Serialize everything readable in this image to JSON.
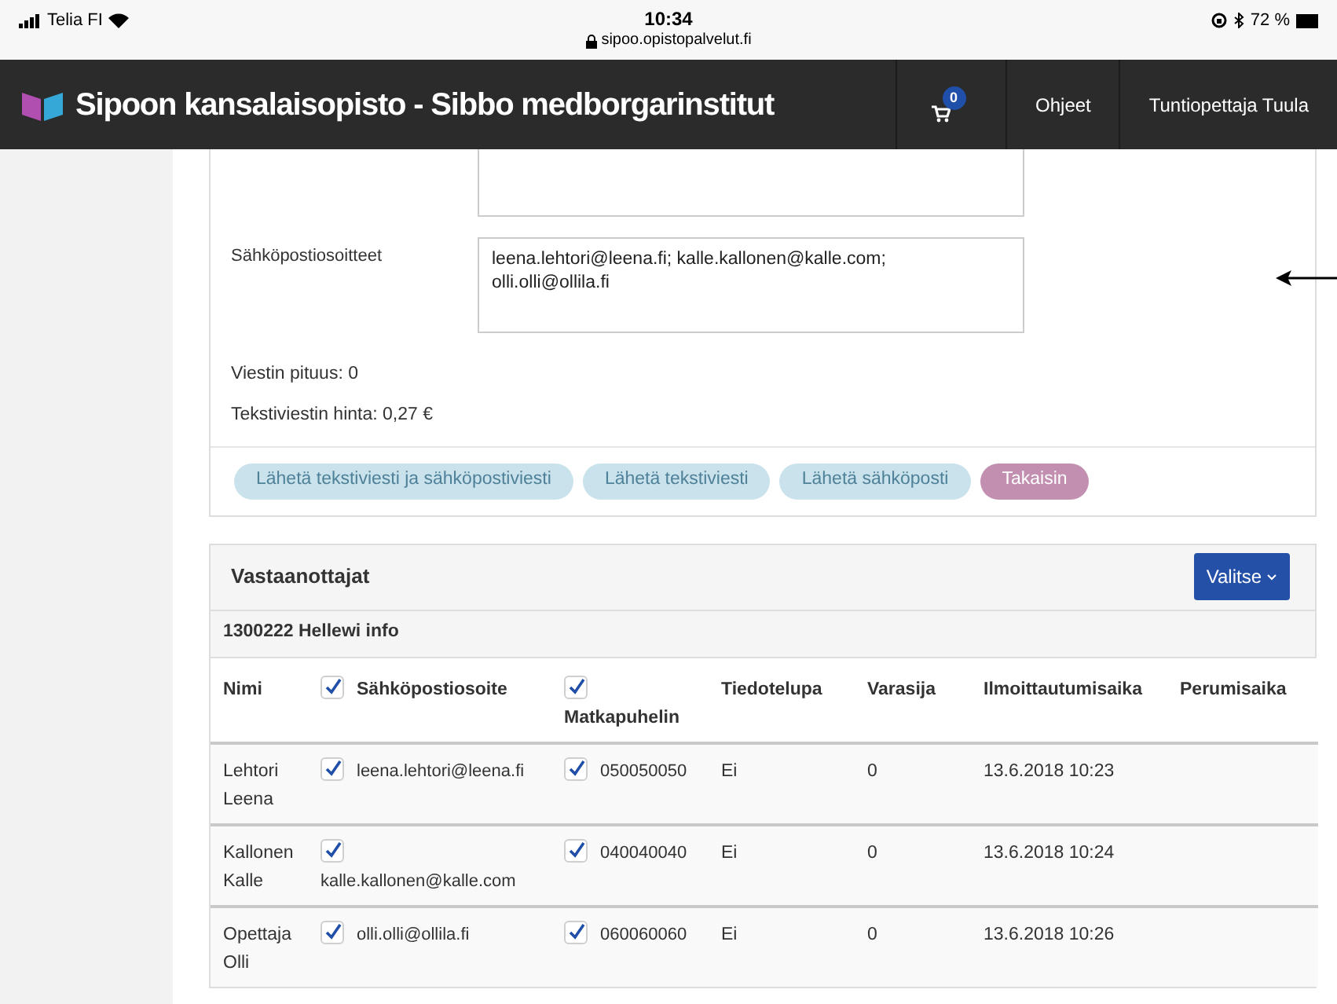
{
  "status_bar": {
    "carrier": "Telia FI",
    "time": "10:34",
    "url": "sipoo.opistopalvelut.fi",
    "battery": "72 %"
  },
  "navbar": {
    "title": "Sipoon kansalaisopisto - Sibbo medborgarinstitut",
    "cart_count": "0",
    "links": [
      "Ohjeet",
      "Tuntiopettaja Tuula"
    ]
  },
  "message_form": {
    "email_label": "Sähköpostiosoitteet",
    "email_value": "leena.lehtori@leena.fi; kalle.kallonen@kalle.com; olli.olli@ollila.fi",
    "length": "Viestin pituus: 0",
    "price": "Tekstiviestin hinta: 0,27 €",
    "buttons": [
      {
        "label": "Lähetä tekstiviesti ja sähköpostiviesti",
        "kind": "send",
        "disabled": true
      },
      {
        "label": "Lähetä tekstiviesti",
        "kind": "send",
        "disabled": true
      },
      {
        "label": "Lähetä sähköposti",
        "kind": "send",
        "disabled": true
      },
      {
        "label": "Takaisin",
        "kind": "back",
        "disabled": false
      }
    ]
  },
  "recipients": {
    "title": "Vastaanottajat",
    "select_button": "Valitse",
    "group": "1300222 Hellewi info",
    "columns": [
      {
        "label": "Nimi"
      },
      {
        "label": "Sähköpostiosoite",
        "checked": true
      },
      {
        "label": "Matkapuhelin",
        "checked": true
      },
      {
        "label": "Tiedotelupa"
      },
      {
        "label": "Varasija"
      },
      {
        "label": "Ilmoittautumisaika"
      },
      {
        "label": "Perumisaika"
      }
    ],
    "rows": [
      {
        "name": "Lehtori Leena",
        "email": "leena.lehtori@leena.fi",
        "email_checked": true,
        "phone": "050050050",
        "phone_checked": true,
        "permission": "Ei",
        "reserve": "0",
        "registered": "13.6.2018 10:23"
      },
      {
        "name": "Kallonen Kalle",
        "email": "kalle.kallonen@kalle.com",
        "email_checked": true,
        "phone": "040040040",
        "phone_checked": true,
        "permission": "Ei",
        "reserve": "0",
        "registered": "13.6.2018 10:24"
      },
      {
        "name": "Opettaja Olli",
        "email": "olli.olli@ollila.fi",
        "email_checked": true,
        "phone": "060060060",
        "phone_checked": true,
        "permission": "Ei",
        "reserve": "0",
        "registered": "13.6.2018 10:26"
      }
    ]
  }
}
